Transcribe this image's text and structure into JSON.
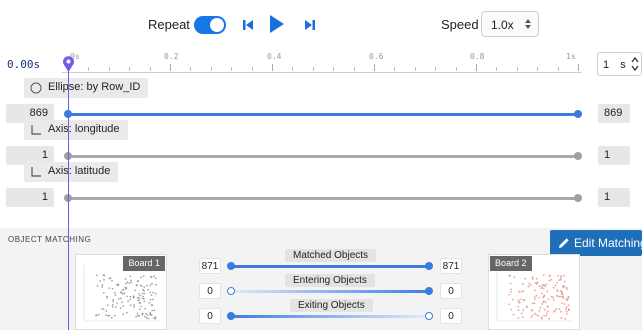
{
  "toolbar": {
    "repeat_label": "Repeat",
    "repeat_on": true,
    "speed_label": "Speed",
    "speed_value": "1.0x"
  },
  "timeline": {
    "current_time": "0.00s",
    "ticks": [
      "0s",
      "0.2",
      "0.4",
      "0.6",
      "0.8",
      "1s"
    ],
    "duration_value": "1",
    "duration_unit": "s"
  },
  "tracks": [
    {
      "label": "Ellipse: by Row_ID",
      "icon": "circle-icon",
      "start": "869",
      "end": "869",
      "color": "#3a7be0"
    },
    {
      "label": "Axis: longitude",
      "icon": "axis-icon",
      "start": "1",
      "end": "1",
      "color": "#a9a9a9"
    },
    {
      "label": "Axis: latitude",
      "icon": "axis-icon",
      "start": "1",
      "end": "1",
      "color": "#a9a9a9"
    }
  ],
  "object_matching": {
    "title": "OBJECT MATCHING",
    "edit_button": "Edit Matching",
    "board_left": "Board 1",
    "board_right": "Board 2",
    "metrics": [
      {
        "label": "Matched Objects",
        "left": "871",
        "right": "871"
      },
      {
        "label": "Entering Objects",
        "left": "0",
        "right": "0"
      },
      {
        "label": "Exiting Objects",
        "left": "0",
        "right": "0"
      }
    ]
  },
  "colors": {
    "accent": "#1677e8",
    "playhead": "#6c5ce7",
    "edit_button": "#1e6fb8"
  }
}
